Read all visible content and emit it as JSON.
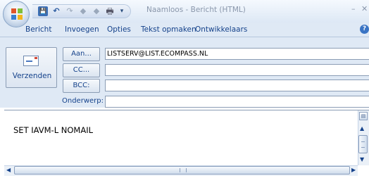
{
  "window": {
    "title": "Naamloos - Bericht (HTML)",
    "minimize_glyph": "–",
    "close_glyph": "✕"
  },
  "quick_access": {
    "save_glyph": "💾",
    "undo_glyph": "↶",
    "redo_glyph": "↷",
    "prev_glyph": "◆",
    "next_glyph": "◆",
    "print_glyph": "🖶",
    "dropdown_glyph": "▾"
  },
  "ribbon": {
    "tabs": [
      "Bericht",
      "Invoegen",
      "Opties",
      "Tekst opmaken",
      "Ontwikkelaars"
    ],
    "help_glyph": "?"
  },
  "compose": {
    "send_label": "Verzenden",
    "to_label": "Aan...",
    "to_value": "LISTSERV@LIST.ECOMPASS.NL",
    "cc_label": "CC...",
    "cc_value": "",
    "bcc_label": "BCC:",
    "bcc_value": "",
    "subject_label": "Onderwerp:",
    "subject_value": "",
    "body_text": "SET IAVM-L NOMAIL"
  },
  "scrollbars": {
    "up_glyph": "▲",
    "down_glyph": "▼",
    "left_glyph": "◀",
    "right_glyph": "▶",
    "grip_glyph": "III",
    "ruler_glyph": "▤"
  },
  "colors": {
    "ribbon_background": "#dfe9f5",
    "label_text": "#15428b"
  }
}
